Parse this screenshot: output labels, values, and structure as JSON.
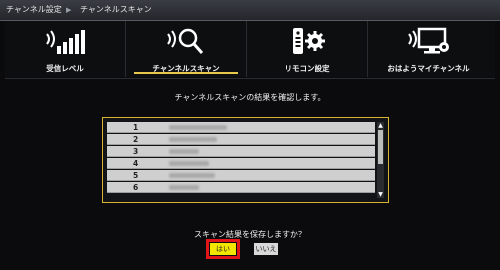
{
  "breadcrumb": {
    "parent": "チャンネル設定",
    "separator": "▶",
    "current": "チャンネルスキャン"
  },
  "tabs": [
    {
      "label": "受信レベル",
      "icon": "signal-strength-icon"
    },
    {
      "label": "チャンネルスキャン",
      "icon": "broadcast-search-icon"
    },
    {
      "label": "リモコン設定",
      "icon": "remote-settings-icon"
    },
    {
      "label": "おはようマイチャンネル",
      "icon": "broadcast-tv-icon"
    }
  ],
  "main": {
    "instruction": "チャンネルスキャンの結果を確認します。",
    "rows": [
      {
        "number": "1"
      },
      {
        "number": "2"
      },
      {
        "number": "3"
      },
      {
        "number": "4"
      },
      {
        "number": "5"
      },
      {
        "number": "6"
      }
    ],
    "question": "スキャン結果を保存しますか？",
    "yes_label": "はい",
    "no_label": "いいえ"
  },
  "colors": {
    "accent": "#e8c94a",
    "highlight": "#e0161b",
    "yes_button": "#f2e600"
  }
}
